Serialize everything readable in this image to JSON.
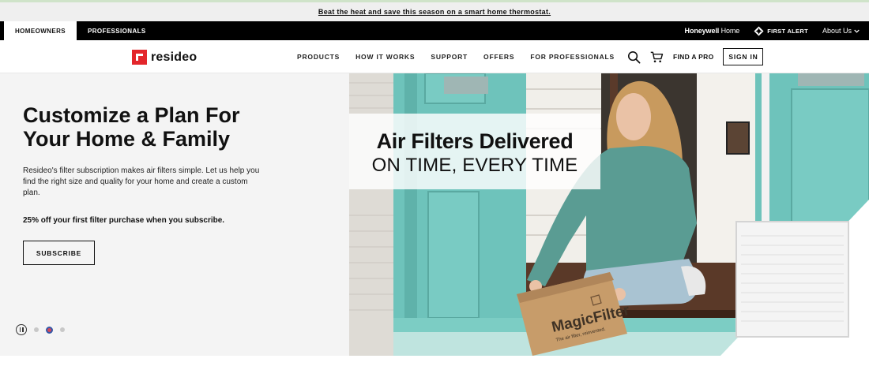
{
  "promo": {
    "text": "Beat the heat and save this season on a smart home thermostat."
  },
  "top_bar": {
    "tabs": [
      {
        "label": "HOMEOWNERS",
        "active": true
      },
      {
        "label": "PROFESSIONALS",
        "active": false
      }
    ],
    "honeywell_bold": "Honeywell",
    "honeywell_light": " Home",
    "first_alert": "FIRST ALERT",
    "about": "About Us"
  },
  "nav": {
    "logo": "resideo",
    "items": [
      "PRODUCTS",
      "HOW IT WORKS",
      "SUPPORT",
      "OFFERS",
      "FOR PROFESSIONALS"
    ],
    "find_pro": "FIND A PRO",
    "sign_in": "SIGN IN"
  },
  "hero": {
    "title_line1": "Customize a Plan For",
    "title_line2": "Your Home & Family",
    "description": "Resideo's filter subscription makes air filters simple. Let us help you find the right size and quality for your home and create a custom plan.",
    "offer": "25% off your first filter purchase when you subscribe.",
    "cta": "SUBSCRIBE",
    "headline1": "Air Filters Delivered",
    "headline2": "ON TIME, EVERY TIME",
    "box_brand": "MagicFilter",
    "box_tagline": "The air filter, reinvented.",
    "carousel": {
      "slides": 3,
      "active": 2
    }
  },
  "colors": {
    "accent": "#e3262b",
    "teal": "#6bc0b8",
    "black": "#000000"
  }
}
